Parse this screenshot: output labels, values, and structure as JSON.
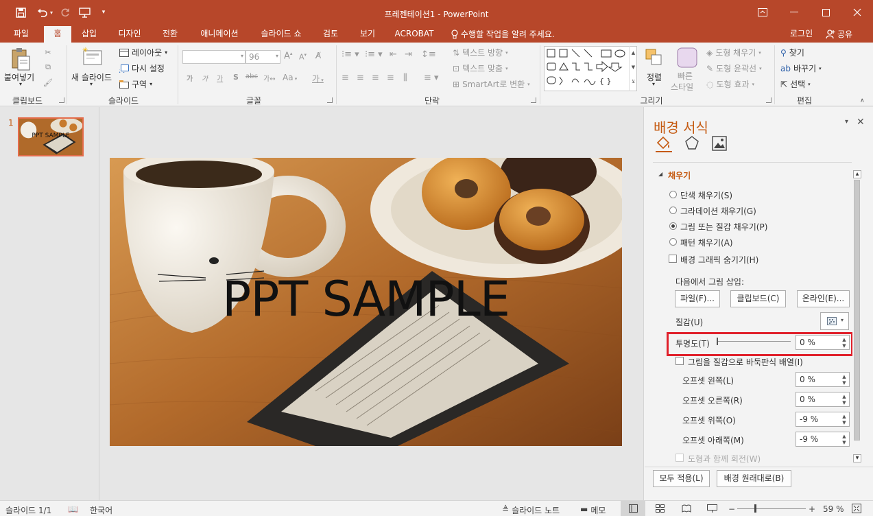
{
  "window": {
    "title": "프레젠테이션1 - PowerPoint"
  },
  "tabs": [
    {
      "label": "파일"
    },
    {
      "label": "홈"
    },
    {
      "label": "삽입"
    },
    {
      "label": "디자인"
    },
    {
      "label": "전환"
    },
    {
      "label": "애니메이션"
    },
    {
      "label": "슬라이드 쇼"
    },
    {
      "label": "검토"
    },
    {
      "label": "보기"
    },
    {
      "label": "ACROBAT"
    }
  ],
  "tell_me": "수행할 작업을 알려 주세요.",
  "login": "로그인",
  "share": "공유",
  "ribbon": {
    "clipboard": {
      "paste": "붙여넣기",
      "group": "클립보드"
    },
    "slides": {
      "new_slide": "새 슬라이드",
      "layout": "레이아웃",
      "reset": "다시 설정",
      "section": "구역",
      "group": "슬라이드"
    },
    "font": {
      "font_name": "",
      "font_size": "96",
      "group": "글꼴",
      "korean_label": "가",
      "case_label": "Aa"
    },
    "paragraph": {
      "text_direction": "텍스트 방향",
      "align_text": "텍스트 맞춤",
      "smartart": "SmartArt로 변환",
      "group": "단락"
    },
    "drawing": {
      "arrange": "정렬",
      "quick_styles_line1": "빠른",
      "quick_styles_line2": "스타일",
      "shape_fill": "도형 채우기",
      "shape_outline": "도형 윤곽선",
      "shape_effects": "도형 효과",
      "group": "그리기"
    },
    "editing": {
      "find": "찾기",
      "replace": "바꾸기",
      "select": "선택",
      "group": "편집"
    }
  },
  "thumbnail": {
    "number": "1",
    "text": "PPT SAMPLE"
  },
  "slide": {
    "text": "PPT SAMPLE"
  },
  "pane": {
    "title": "배경 서식",
    "section": "채우기",
    "fill_options": [
      {
        "label": "단색 채우기(S)",
        "selected": false
      },
      {
        "label": "그라데이션 채우기(G)",
        "selected": false
      },
      {
        "label": "그림 또는 질감 채우기(P)",
        "selected": true
      },
      {
        "label": "패턴 채우기(A)",
        "selected": false
      }
    ],
    "hide_graphics": "배경 그래픽 숨기기(H)",
    "insert_from": "다음에서 그림 삽입:",
    "file_btn": "파일(F)...",
    "clipboard_btn": "클립보드(C)",
    "online_btn": "온라인(E)...",
    "texture": "질감(U)",
    "transparency": {
      "label": "투명도(T)",
      "value": "0 %",
      "fraction": 0
    },
    "tile": "그림을 질감으로 바둑판식 배열(I)",
    "offsets": [
      {
        "label": "오프셋 왼쪽(L)",
        "value": "0 %"
      },
      {
        "label": "오프셋 오른쪽(R)",
        "value": "0 %"
      },
      {
        "label": "오프셋 위쪽(O)",
        "value": "-9 %"
      },
      {
        "label": "오프셋 아래쪽(M)",
        "value": "-9 %"
      }
    ],
    "rotate_with_shape": "도형과 함께 회전(W)",
    "apply_all": "모두 적용(L)",
    "reset_bg": "배경 원래대로(B)"
  },
  "status": {
    "slide": "슬라이드 1/1",
    "language": "한국어",
    "notes": "슬라이드 노트",
    "comments": "메모",
    "zoom": "59 %"
  },
  "colors": {
    "accent": "#b7472a",
    "pane_title": "#c55a11",
    "highlight": "#e0202a"
  }
}
